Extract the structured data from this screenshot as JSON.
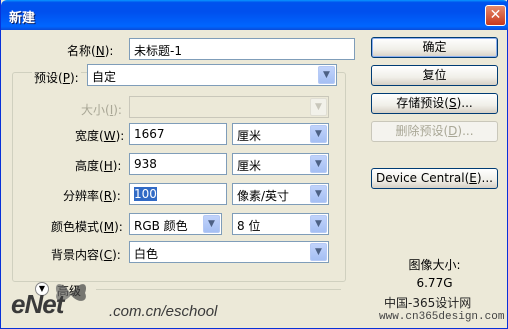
{
  "window": {
    "title": "新建",
    "close_glyph": "✕"
  },
  "form": {
    "name": {
      "label": "名称",
      "key": "N",
      "value": "未标题-1"
    },
    "preset": {
      "label": "预设",
      "key": "P",
      "value": "自定"
    },
    "size": {
      "label": "大小",
      "key": "I",
      "value": ""
    },
    "width": {
      "label": "宽度",
      "key": "W",
      "value": "1667",
      "unit": "厘米"
    },
    "height": {
      "label": "高度",
      "key": "H",
      "value": "938",
      "unit": "厘米"
    },
    "resolution": {
      "label": "分辨率",
      "key": "R",
      "value": "100",
      "unit": "像素/英寸"
    },
    "color_mode": {
      "label": "颜色模式",
      "key": "M",
      "value": "RGB 颜色",
      "depth": "8 位"
    },
    "background": {
      "label": "背景内容",
      "key": "C",
      "value": "白色"
    },
    "advanced": {
      "label": "高级"
    }
  },
  "buttons": {
    "ok": "确定",
    "reset": "复位",
    "save_preset": {
      "text": "存储预设(",
      "key": "S",
      "tail": ")..."
    },
    "delete_preset": {
      "text": "删除预设(",
      "key": "D",
      "tail": ")..."
    },
    "device_central": {
      "text": "Device Central(",
      "key": "E",
      "tail": ")..."
    }
  },
  "info": {
    "label": "图像大小:",
    "value": "6.77G"
  },
  "watermark": {
    "brand": "eNet",
    "url": ".com.cn/eschool",
    "cn": "中国-365设计网",
    "site": "www.cn365design.com"
  },
  "colors": {
    "title_bar": "#0054e3",
    "dialog_bg": "#ece9d8",
    "selection": "#316ac5"
  }
}
